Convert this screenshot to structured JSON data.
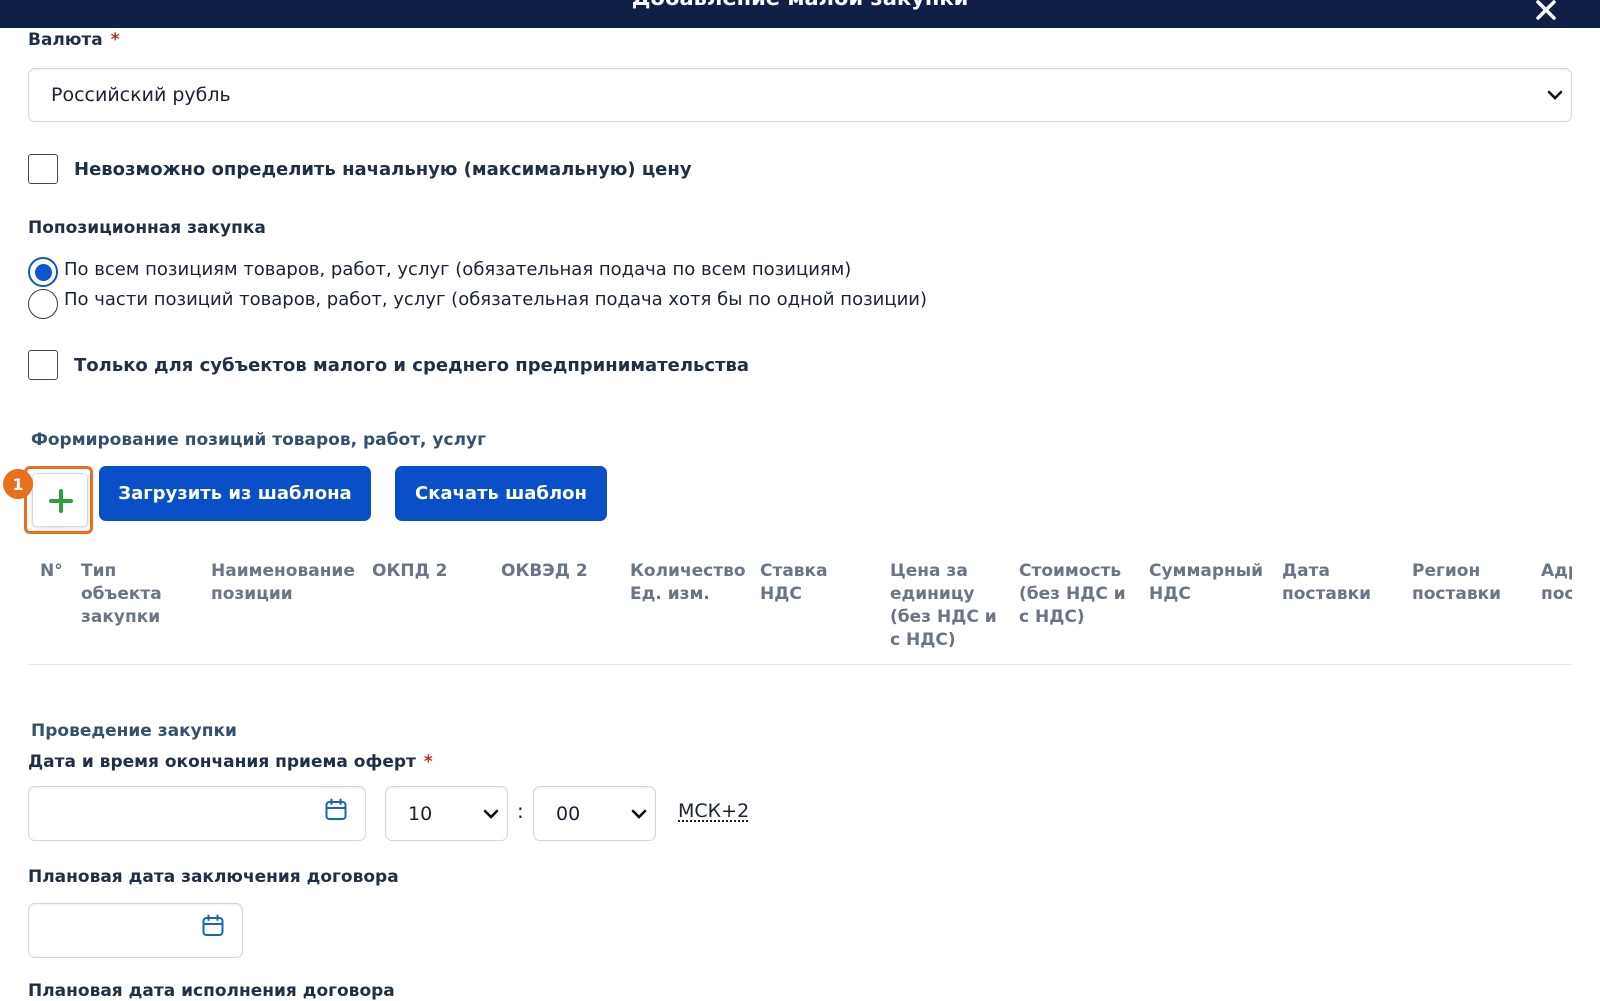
{
  "modal": {
    "title": "Добавление малой закупки"
  },
  "currency": {
    "label": "Валюта",
    "required_mark": "*",
    "selected": "Российский рубль"
  },
  "no_price_checkbox": {
    "label": "Невозможно определить начальную (максимальную) цену",
    "checked": false
  },
  "positional": {
    "label": "Попозиционная закупка",
    "options": [
      {
        "label": "По всем позициям товаров, работ, услуг (обязательная подача по всем позициям)",
        "checked": true
      },
      {
        "label": "По части позиций товаров, работ, услуг (обязательная подача хотя бы по одной позиции)",
        "checked": false
      }
    ]
  },
  "sme_checkbox": {
    "label": "Только для субъектов малого и среднего предпринимательства",
    "checked": false
  },
  "positions": {
    "section_title": "Формирование позиций товаров, работ, услуг",
    "step_badge": "1",
    "load_template_label": "Загрузить из шаблона",
    "download_template_label": "Скачать шаблон",
    "table_headers": [
      "N°",
      "Тип\nобъекта\nзакупки",
      "Наименование\nпозиции",
      "ОКПД 2",
      "ОКВЭД 2",
      "Количество\nЕд. изм.",
      "Ставка\nНДС",
      "Цена за\nединицу\n(без НДС и\nс НДС)",
      "Стоимость\n(без НДС и\nс НДС)",
      "Суммарный\nНДС",
      "Дата\nпоставки",
      "Регион\nпоставки",
      "Адрес\nпоставки"
    ]
  },
  "conduct": {
    "section_title": "Проведение закупки",
    "deadline_label": "Дата и время окончания приема оферт",
    "required_mark": "*",
    "date_value": "",
    "hour": "10",
    "minute": "00",
    "separator": ":",
    "timezone": "МСК+2",
    "contract_date_label": "Плановая дата заключения договора",
    "contract_date_value": "",
    "execution_date_label": "Плановая дата исполнения договора"
  },
  "colors": {
    "header_bg": "#0f1f46",
    "primary_button": "#0b4fc8",
    "highlight": "#f06a1f",
    "plus_icon": "#2e9e3e",
    "required": "#c62828"
  }
}
